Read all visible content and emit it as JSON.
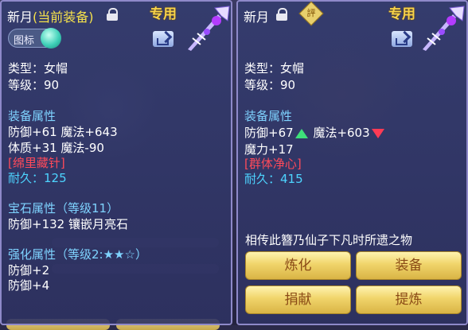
{
  "left_panel": {
    "item_name": "新月",
    "status": "(当前装备)",
    "exclusive_label": "专用",
    "icon_toggle_label": "图标",
    "type_line": "类型：女帽",
    "level_line": "等级：90",
    "attr_header": "装备属性",
    "attr_line1": "防御+61 魔法+643",
    "attr_line2": "体质+31 魔法-90",
    "special": "[绵里藏针]",
    "durability": "耐久：125",
    "gem_header": "宝石属性（等级11）",
    "gem_line": "防御+132 镶嵌月亮石",
    "enhance_header": "强化属性（等级2:★★☆）",
    "enhance_line1": "防御+2",
    "enhance_line2": "防御+4"
  },
  "right_panel": {
    "item_name": "新月",
    "rune_glyph": "評",
    "exclusive_label": "专用",
    "type_line": "类型：女帽",
    "level_line": "等级：90",
    "attr_header": "装备属性",
    "attr_def": "防御+67",
    "attr_magic": "魔法+603",
    "attr_line2": "魔力+17",
    "special": "[群体净心]",
    "durability": "耐久：415",
    "flavor": "相传此簪乃仙子下凡时所遗之物",
    "buttons": {
      "refine": "炼化",
      "equip": "装备",
      "donate": "捐献",
      "extract": "提炼"
    }
  },
  "colors": {
    "gold_text": "#f6e24b",
    "cyan_text": "#4dd4ff",
    "red_text": "#ff4a5a",
    "header_text": "#7fd3ff",
    "up_arrow": "#3ee07a",
    "down_arrow": "#ff3b55"
  }
}
